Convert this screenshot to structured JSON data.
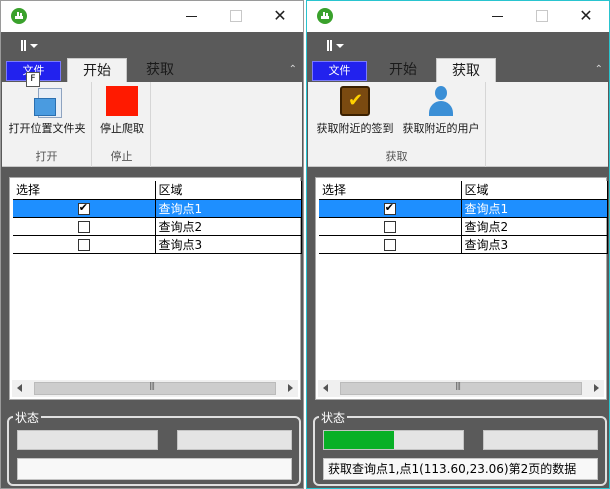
{
  "left_window": {
    "file_tab": "文件",
    "keytip": "F",
    "tabs": [
      {
        "label": "开始",
        "active": true
      },
      {
        "label": "获取",
        "active": false
      }
    ],
    "groups": [
      {
        "label": "打开",
        "buttons": [
          {
            "label": "打开位置文件夹",
            "icon": "folder-icon"
          }
        ]
      },
      {
        "label": "停止",
        "buttons": [
          {
            "label": "停止爬取",
            "icon": "stop-icon"
          }
        ]
      }
    ],
    "grid": {
      "columns": [
        "选择",
        "区域"
      ],
      "rows": [
        {
          "checked": true,
          "area": "查询点1",
          "selected": true
        },
        {
          "checked": false,
          "area": "查询点2",
          "selected": false
        },
        {
          "checked": false,
          "area": "查询点3",
          "selected": false
        }
      ]
    },
    "status": {
      "legend": "状态",
      "progress": 0,
      "message": ""
    }
  },
  "right_window": {
    "file_tab": "文件",
    "tabs": [
      {
        "label": "开始",
        "active": false
      },
      {
        "label": "获取",
        "active": true
      }
    ],
    "groups": [
      {
        "label": "获取",
        "buttons": [
          {
            "label": "获取附近的签到",
            "icon": "checkin-icon"
          },
          {
            "label": "获取附近的用户",
            "icon": "user-icon"
          }
        ]
      }
    ],
    "grid": {
      "columns": [
        "选择",
        "区域"
      ],
      "rows": [
        {
          "checked": true,
          "area": "查询点1",
          "selected": true
        },
        {
          "checked": false,
          "area": "查询点2",
          "selected": false
        },
        {
          "checked": false,
          "area": "查询点3",
          "selected": false
        }
      ]
    },
    "status": {
      "legend": "状态",
      "progress": 0.5,
      "message": "获取查询点1,点1(113.60,23.06)第2页的数据"
    }
  },
  "colors": {
    "progress": "#08b026",
    "file_tab": "#2222ee",
    "selection": "#1e8fff",
    "stop": "#ff1a00",
    "active_border": "#29c4cf"
  }
}
